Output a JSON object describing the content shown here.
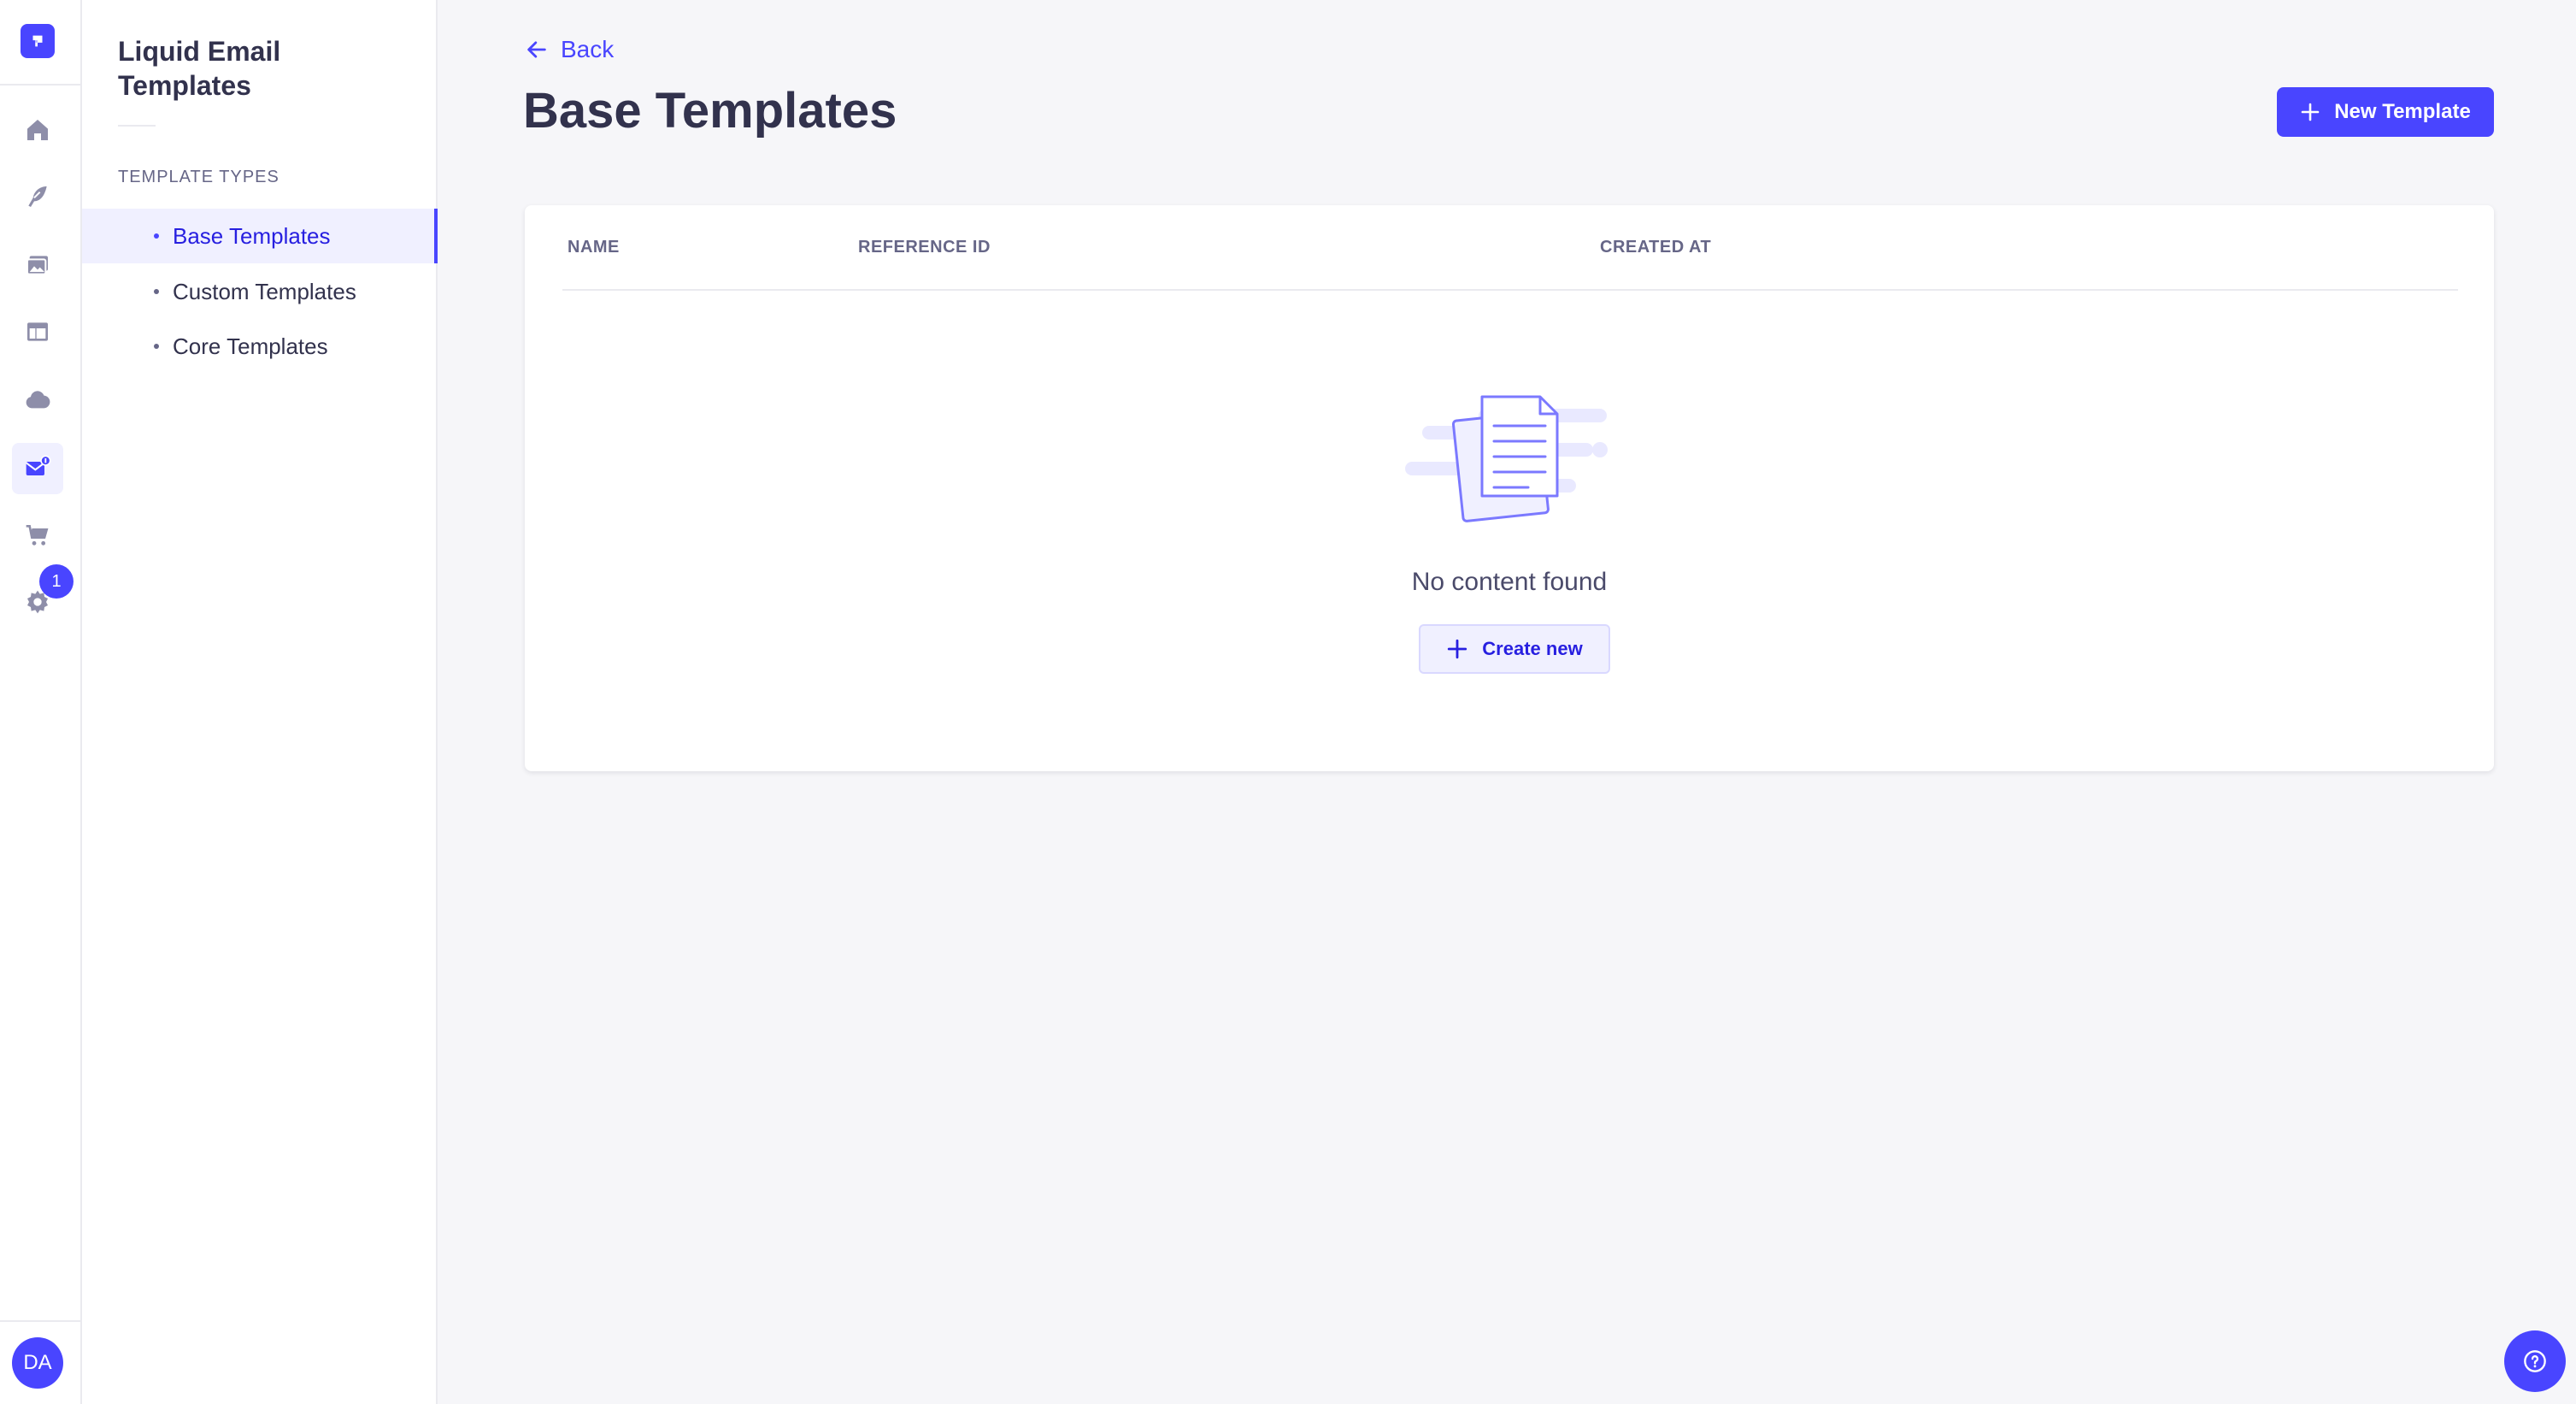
{
  "rail": {
    "icons": [
      "logo-icon",
      "home-icon",
      "content-manager-icon",
      "media-library-icon",
      "layout-icon",
      "cloud-icon",
      "email-templates-icon",
      "cart-icon",
      "settings-icon"
    ],
    "settings_badge": "1",
    "avatar_initials": "DA",
    "accent": "#4945ff"
  },
  "subnav": {
    "title": "Liquid Email Templates",
    "section_label": "TEMPLATE TYPES",
    "items": [
      {
        "label": "Base Templates",
        "active": true
      },
      {
        "label": "Custom Templates",
        "active": false
      },
      {
        "label": "Core Templates",
        "active": false
      }
    ]
  },
  "header": {
    "back_label": "Back",
    "title": "Base Templates",
    "new_button_label": "New Template"
  },
  "table": {
    "columns": [
      "NAME",
      "REFERENCE ID",
      "CREATED AT"
    ],
    "rows": []
  },
  "empty_state": {
    "message": "No content found",
    "create_label": "Create new"
  }
}
